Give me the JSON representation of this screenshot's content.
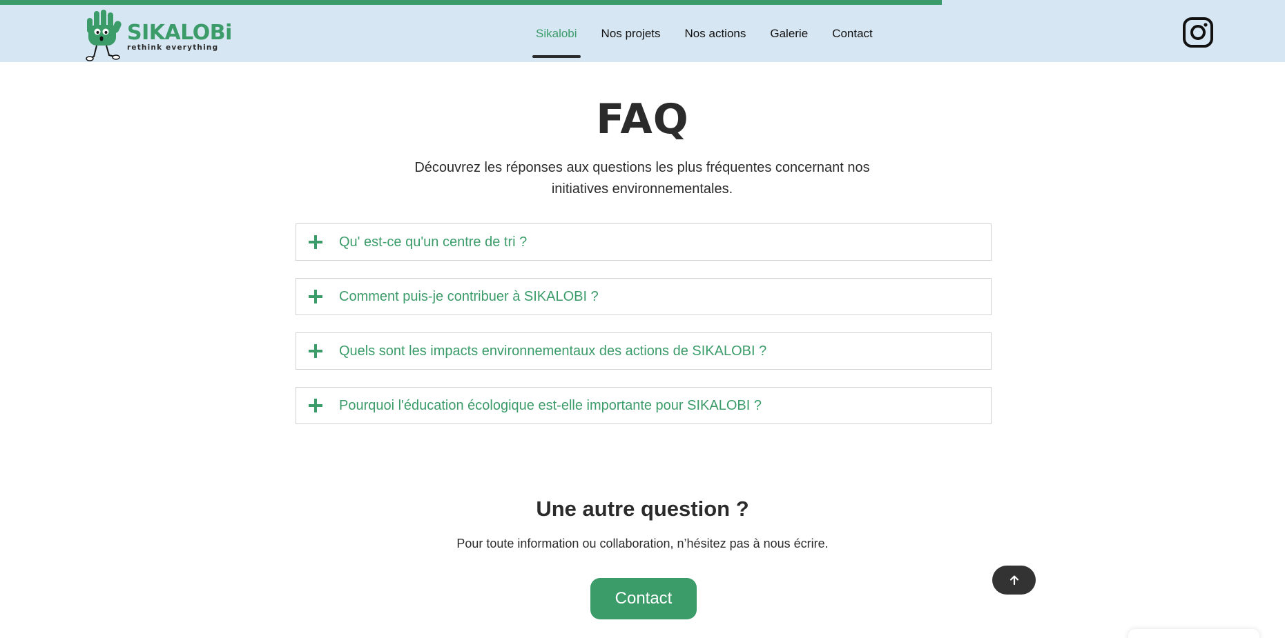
{
  "scroll_progress": 0.733,
  "colors": {
    "accent": "#3b9c6a",
    "header_bg": "#d6e6f2",
    "text": "#2b2b2b"
  },
  "logo": {
    "name": "SIKALOBi",
    "tagline": "rethink everything",
    "mascot_icon": "green-glove-mascot"
  },
  "nav": {
    "items": [
      {
        "label": "Sikalobi",
        "active": true
      },
      {
        "label": "Nos projets"
      },
      {
        "label": "Nos actions"
      },
      {
        "label": "Galerie"
      },
      {
        "label": "Contact"
      }
    ],
    "social_icon": "instagram-icon"
  },
  "faq": {
    "title": "FAQ",
    "subtitle": "Découvrez les réponses aux questions les plus fréquentes concernant nos initiatives environnementales.",
    "expand_icon": "plus-icon",
    "items": [
      {
        "question": "Qu' est-ce qu'un centre de tri ?"
      },
      {
        "question": "Comment puis-je contribuer à SIKALOBI ?"
      },
      {
        "question": "Quels sont les impacts environnementaux des actions de SIKALOBI ?"
      },
      {
        "question": "Pourquoi l'éducation écologique est-elle importante pour SIKALOBI ?"
      }
    ]
  },
  "contact_section": {
    "title": "Une autre question ?",
    "text": "Pour toute information ou collaboration, n’hésitez pas à nous écrire.",
    "button_label": "Contact"
  },
  "scroll_top_icon": "arrow-up-icon"
}
